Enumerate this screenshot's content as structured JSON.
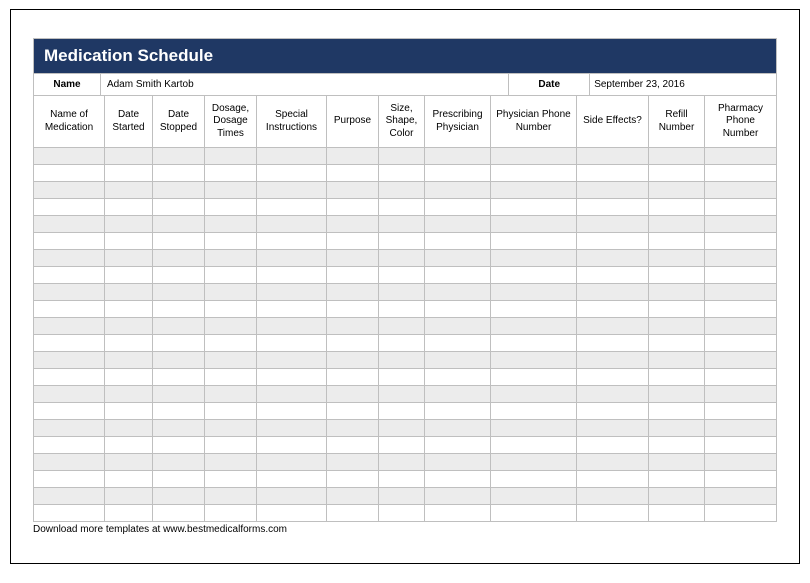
{
  "title": "Medication Schedule",
  "meta": {
    "name_label": "Name",
    "name_value": "Adam Smith Kartob",
    "date_label": "Date",
    "date_value": "September 23, 2016"
  },
  "columns": [
    "Name of Medication",
    "Date Started",
    "Date Stopped",
    "Dosage, Dosage Times",
    "Special Instructions",
    "Purpose",
    "Size, Shape, Color",
    "Prescribing Physician",
    "Physician Phone Number",
    "Side Effects?",
    "Refill Number",
    "Pharmacy Phone Number"
  ],
  "row_count": 22,
  "footer": "Download more templates at www.bestmedicalforms.com"
}
